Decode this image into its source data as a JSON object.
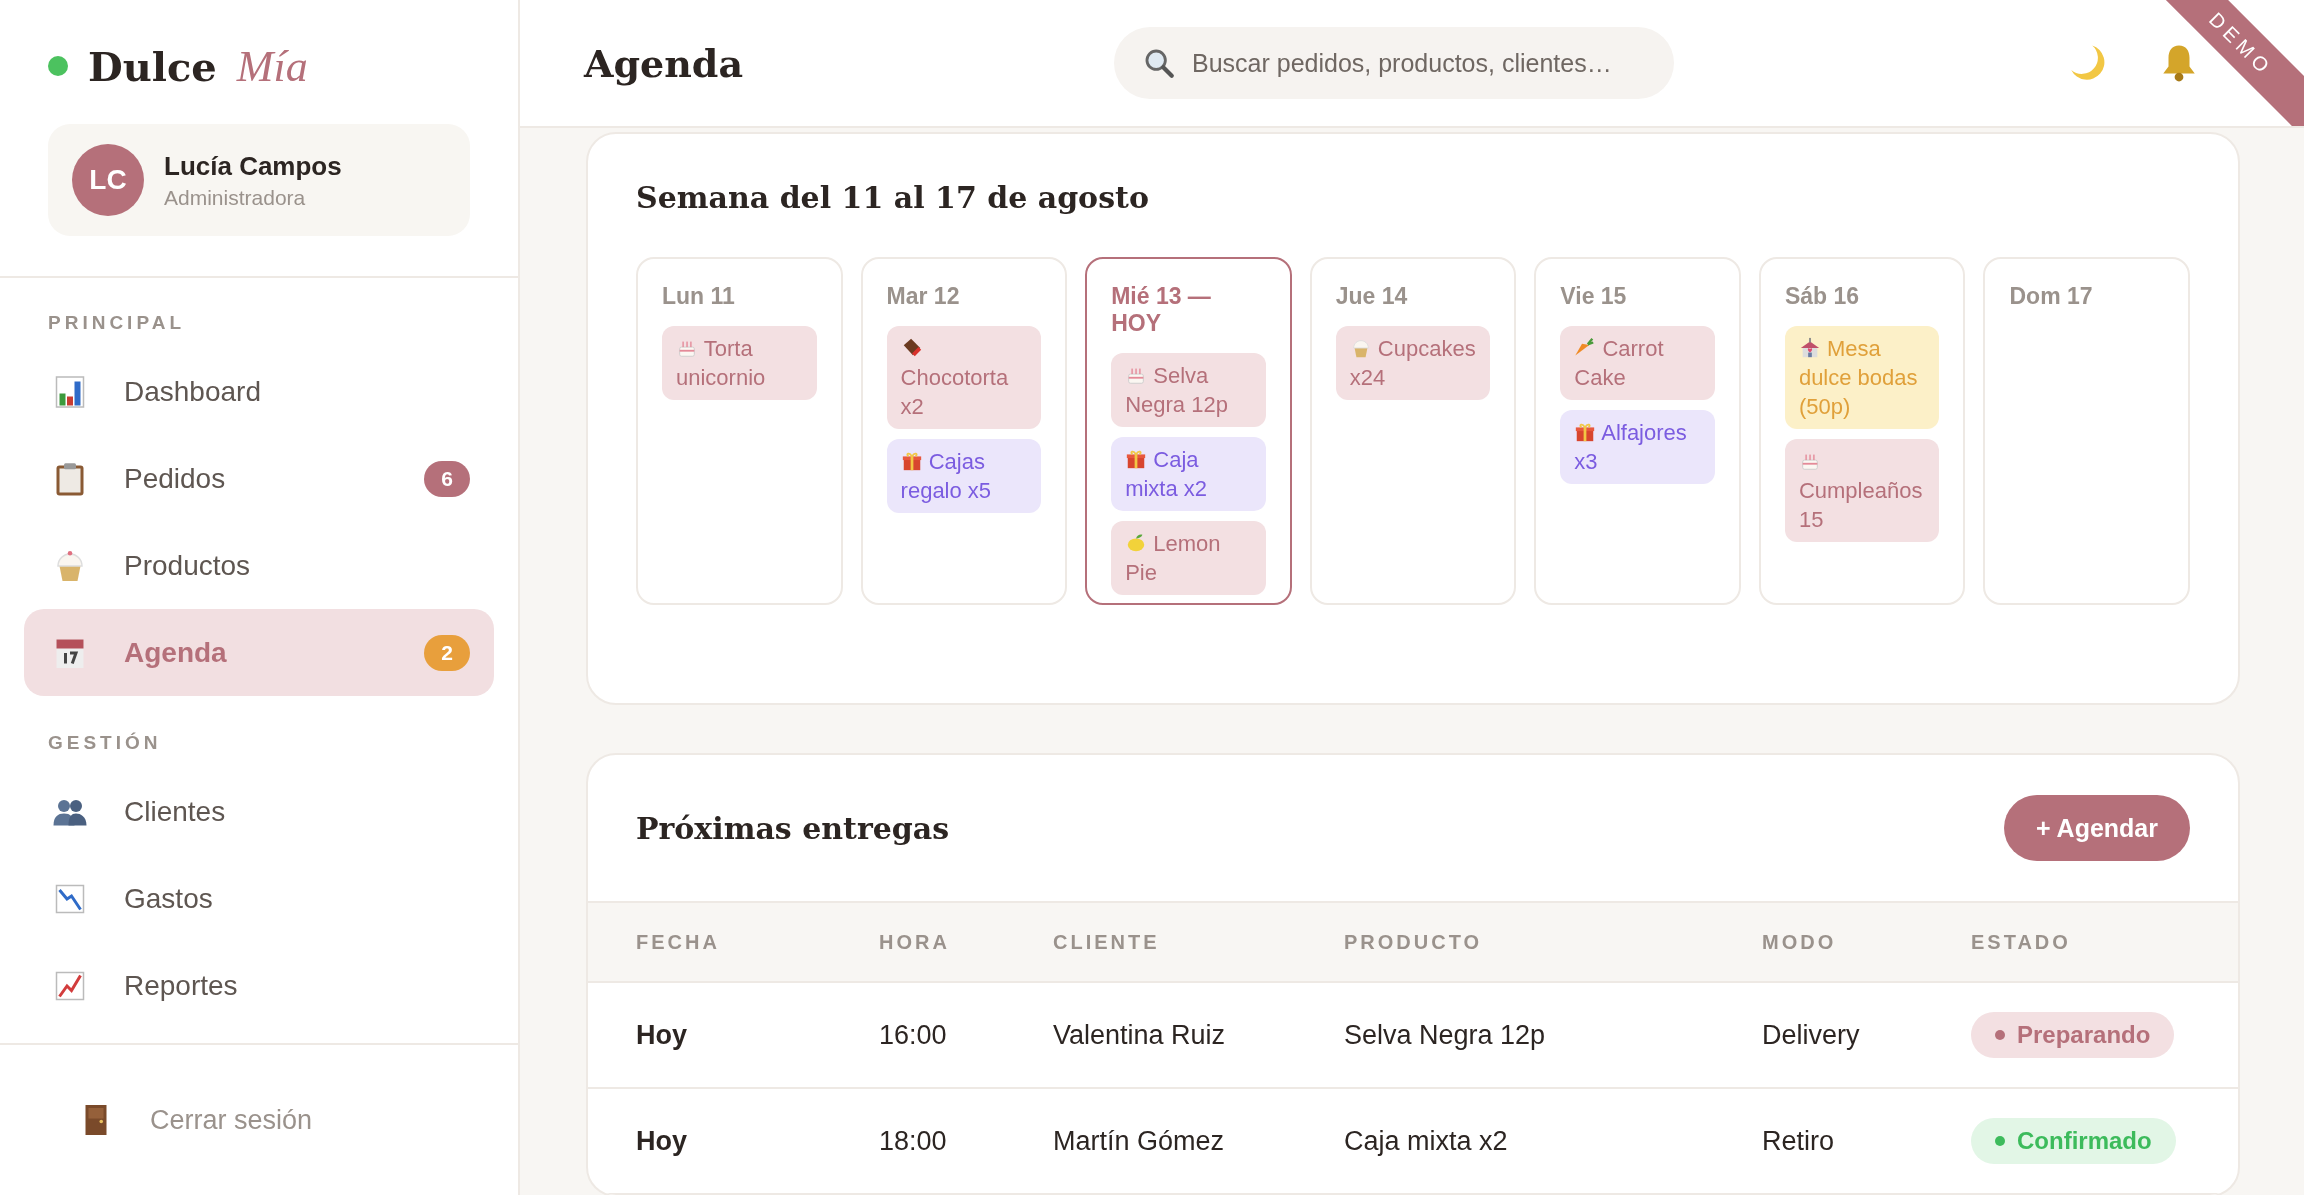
{
  "brand": {
    "name": "Dulce",
    "accent": "Mía"
  },
  "user": {
    "initials": "LC",
    "name": "Lucía Campos",
    "role": "Administradora"
  },
  "nav_sections": [
    {
      "title": "PRINCIPAL",
      "items": [
        {
          "label": "Dashboard",
          "kind": "dashboard",
          "selected": false
        },
        {
          "label": "Pedidos",
          "kind": "orders",
          "selected": false,
          "badge": {
            "text": "6",
            "color": "#b5707a"
          }
        },
        {
          "label": "Productos",
          "kind": "products",
          "selected": false
        },
        {
          "label": "Agenda",
          "kind": "agenda",
          "selected": true,
          "badge": {
            "text": "2",
            "color": "#e89f3c"
          }
        }
      ]
    },
    {
      "title": "GESTIÓN",
      "items": [
        {
          "label": "Clientes",
          "kind": "clients",
          "selected": false
        },
        {
          "label": "Gastos",
          "kind": "expenses",
          "selected": false
        },
        {
          "label": "Reportes",
          "kind": "reports",
          "selected": false
        }
      ]
    }
  ],
  "logout": {
    "label": "Cerrar sesión"
  },
  "header": {
    "title": "Agenda",
    "search": {
      "placeholder": "Buscar pedidos, productos, clientes…"
    }
  },
  "ribbon": "DEMO",
  "week": {
    "title": "Semana del 11 al 17 de agosto",
    "days": [
      {
        "label": "Lun 11",
        "today": false,
        "events": [
          {
            "kind": "cake",
            "text": "Torta unicornio"
          }
        ]
      },
      {
        "label": "Mar 12",
        "today": false,
        "events": [
          {
            "kind": "chocolate",
            "text": "Chocotorta x2"
          },
          {
            "kind": "gift",
            "text": "Cajas regalo x5"
          }
        ]
      },
      {
        "label": "Mié 13 — HOY",
        "today": true,
        "events": [
          {
            "kind": "cake",
            "text": "Selva Negra 12p"
          },
          {
            "kind": "gift",
            "text": "Caja mixta x2"
          },
          {
            "kind": "lemon",
            "text": "Lemon Pie"
          }
        ]
      },
      {
        "label": "Jue 14",
        "today": false,
        "events": [
          {
            "kind": "cupcake",
            "text": "Cupcakes x24"
          }
        ]
      },
      {
        "label": "Vie 15",
        "today": false,
        "events": [
          {
            "kind": "carrot",
            "text": "Carrot Cake"
          },
          {
            "kind": "gift",
            "text": "Alfajores x3"
          }
        ]
      },
      {
        "label": "Sáb 16",
        "today": false,
        "events": [
          {
            "kind": "wedding",
            "text": "Mesa dulce bodas (50p)"
          },
          {
            "kind": "cake",
            "text": "Cumpleaños 15"
          }
        ]
      },
      {
        "label": "Dom 17",
        "today": false
      }
    ]
  },
  "deliveries": {
    "title": "Próximas entregas",
    "button": "+ Agendar",
    "columns": [
      "FECHA",
      "HORA",
      "CLIENTE",
      "PRODUCTO",
      "MODO",
      "ESTADO"
    ],
    "rows": [
      {
        "date": "Hoy",
        "time": "16:00",
        "client": "Valentina Ruiz",
        "product": "Selva Negra 12p",
        "mode": "Delivery",
        "status": {
          "kind": "preparing",
          "text": "Preparando"
        }
      },
      {
        "date": "Hoy",
        "time": "18:00",
        "client": "Martín Gómez",
        "product": "Caja mixta x2",
        "mode": "Retiro",
        "status": {
          "kind": "confirmed",
          "text": "Confirmado"
        }
      }
    ]
  }
}
